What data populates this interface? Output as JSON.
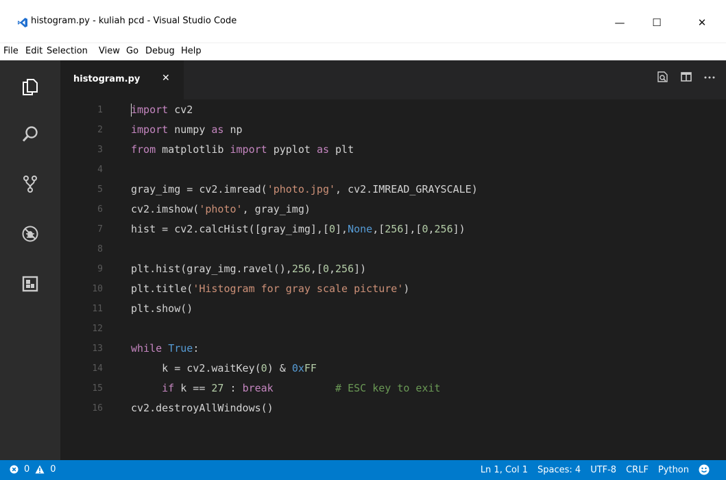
{
  "window": {
    "title": "histogram.py - kuliah pcd - Visual Studio Code",
    "controls": {
      "minimize": "—",
      "maximize": "☐",
      "close": "✕"
    }
  },
  "menu": [
    "File",
    "Edit",
    "Selection",
    "View",
    "Go",
    "Debug",
    "Help"
  ],
  "activity_bar": [
    "files-icon",
    "search-icon",
    "source-control-icon",
    "debug-icon",
    "extensions-icon"
  ],
  "tab": {
    "label": "histogram.py",
    "close": "✕"
  },
  "editor_actions": [
    "open-preview-icon",
    "split-editor-icon",
    "more-actions-icon"
  ],
  "editor": {
    "lines": [
      {
        "n": "1",
        "tokens": [
          {
            "t": "import",
            "c": "kw"
          },
          {
            "t": " cv2"
          }
        ]
      },
      {
        "n": "2",
        "tokens": [
          {
            "t": "import",
            "c": "kw"
          },
          {
            "t": " numpy "
          },
          {
            "t": "as",
            "c": "kw"
          },
          {
            "t": " np"
          }
        ]
      },
      {
        "n": "3",
        "tokens": [
          {
            "t": "from",
            "c": "kw"
          },
          {
            "t": " matplotlib "
          },
          {
            "t": "import",
            "c": "kw"
          },
          {
            "t": " pyplot "
          },
          {
            "t": "as",
            "c": "kw"
          },
          {
            "t": " plt"
          }
        ]
      },
      {
        "n": "4",
        "tokens": []
      },
      {
        "n": "5",
        "tokens": [
          {
            "t": "gray_img = cv2.imread("
          },
          {
            "t": "'photo.jpg'",
            "c": "str"
          },
          {
            "t": ", cv2.IMREAD_GRAYSCALE)"
          }
        ]
      },
      {
        "n": "6",
        "tokens": [
          {
            "t": "cv2.imshow("
          },
          {
            "t": "'photo'",
            "c": "str"
          },
          {
            "t": ", gray_img)"
          }
        ]
      },
      {
        "n": "7",
        "tokens": [
          {
            "t": "hist = cv2.calcHist([gray_img],["
          },
          {
            "t": "0",
            "c": "num"
          },
          {
            "t": "],"
          },
          {
            "t": "None",
            "c": "const"
          },
          {
            "t": ",["
          },
          {
            "t": "256",
            "c": "num"
          },
          {
            "t": "],["
          },
          {
            "t": "0",
            "c": "num"
          },
          {
            "t": ","
          },
          {
            "t": "256",
            "c": "num"
          },
          {
            "t": "])"
          }
        ]
      },
      {
        "n": "8",
        "tokens": []
      },
      {
        "n": "9",
        "tokens": [
          {
            "t": "plt.hist(gray_img.ravel(),"
          },
          {
            "t": "256",
            "c": "num"
          },
          {
            "t": ",["
          },
          {
            "t": "0",
            "c": "num"
          },
          {
            "t": ","
          },
          {
            "t": "256",
            "c": "num"
          },
          {
            "t": "])"
          }
        ]
      },
      {
        "n": "10",
        "tokens": [
          {
            "t": "plt.title("
          },
          {
            "t": "'Histogram for gray scale picture'",
            "c": "str"
          },
          {
            "t": ")"
          }
        ]
      },
      {
        "n": "11",
        "tokens": [
          {
            "t": "plt.show()"
          }
        ]
      },
      {
        "n": "12",
        "tokens": []
      },
      {
        "n": "13",
        "tokens": [
          {
            "t": "while",
            "c": "kw"
          },
          {
            "t": " "
          },
          {
            "t": "True",
            "c": "const"
          },
          {
            "t": ":"
          }
        ]
      },
      {
        "n": "14",
        "tokens": [
          {
            "t": "     k = cv2.waitKey("
          },
          {
            "t": "0",
            "c": "num"
          },
          {
            "t": ") & "
          },
          {
            "t": "0x",
            "c": "const"
          },
          {
            "t": "FF",
            "c": "num"
          }
        ]
      },
      {
        "n": "15",
        "tokens": [
          {
            "t": "     "
          },
          {
            "t": "if",
            "c": "kw"
          },
          {
            "t": " k == "
          },
          {
            "t": "27",
            "c": "num"
          },
          {
            "t": " : "
          },
          {
            "t": "break",
            "c": "kw"
          },
          {
            "t": "          "
          },
          {
            "t": "# ESC key to exit",
            "c": "cmt"
          }
        ]
      },
      {
        "n": "16",
        "tokens": [
          {
            "t": "cv2.destroyAllWindows()"
          }
        ]
      }
    ]
  },
  "status": {
    "errors": "0",
    "warnings": "0",
    "position": "Ln 1, Col 1",
    "spaces": "Spaces: 4",
    "encoding": "UTF-8",
    "eol": "CRLF",
    "language": "Python"
  }
}
